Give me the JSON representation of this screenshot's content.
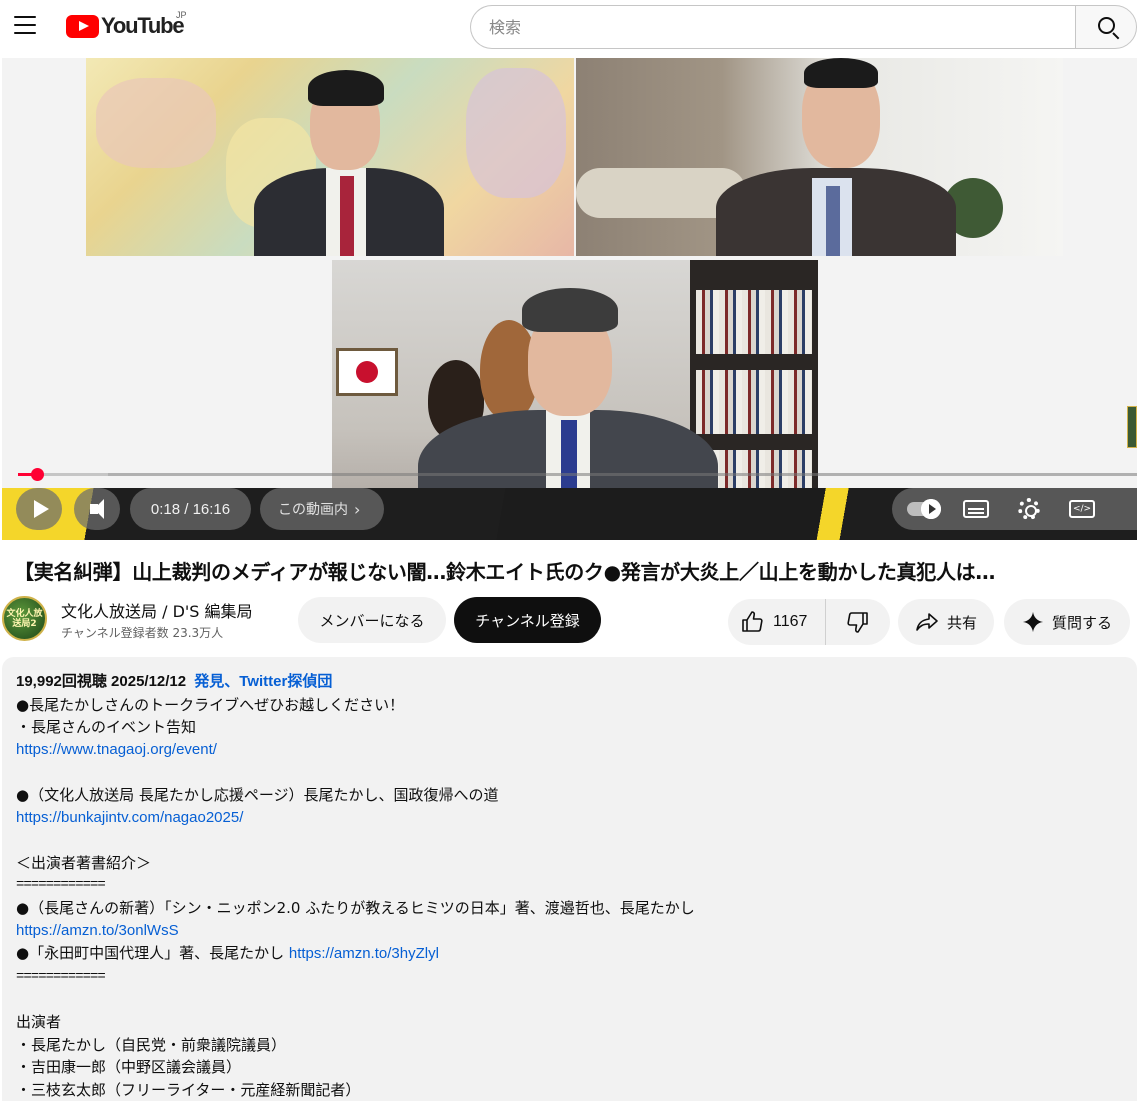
{
  "header": {
    "logo_text": "YouTube",
    "country_code": "JP",
    "search_placeholder": "検索"
  },
  "player": {
    "time_display": "0:18 / 16:16",
    "chapter_label": "この動画内",
    "progress_fraction": 0.0185
  },
  "video": {
    "title": "【実名糾弾】山上裁判のメディアが報じない闇…鈴木エイト氏のク●発言が大炎上／山上を動かした真犯人は…"
  },
  "channel": {
    "avatar_text": "文化人放送局2",
    "name": "文化人放送局 / D'S 編集局",
    "subscribers": "チャンネル登録者数 23.3万人",
    "member_button": "メンバーになる",
    "subscribe_button": "チャンネル登録"
  },
  "actions": {
    "like_count": "1167",
    "share_label": "共有",
    "ask_label": "質問する"
  },
  "description": {
    "views_date": "19,992回視聴  2025/12/12",
    "tags": "発見、Twitter探偵団",
    "lines": {
      "l1": "●長尾たかしさんのトークライブへぜひお越しください！",
      "l2": "・長尾さんのイベント告知",
      "l3": "https://www.tnagaoj.org/event/",
      "l5": "●（文化人放送局 長尾たかし応援ページ）長尾たかし、国政復帰への道",
      "l6": "https://bunkajintv.com/nagao2025/",
      "l8": "＜出演者著書紹介＞",
      "l9": "============",
      "l10": "●（長尾さんの新著）「シン・ニッポン2.0 ふたりが教えるヒミツの日本」著、渡邉哲也、長尾たかし",
      "l11": "https://amzn.to/3onlWsS",
      "l12": "●「永田町中国代理人」著、長尾たかし ",
      "l12_link": "https://amzn.to/3hyZlyl",
      "l13": "============",
      "l15": "出演者",
      "l16": "・長尾たかし（自民党・前衆議院議員）",
      "l17": "・吉田康一郎（中野区議会議員）",
      "l18": "・三枝玄太郎（フリーライター・元産経新聞記者）"
    }
  },
  "colors": {
    "brand_red": "#ff0000",
    "progress_red": "#ff0033",
    "link_blue": "#065fd4"
  }
}
